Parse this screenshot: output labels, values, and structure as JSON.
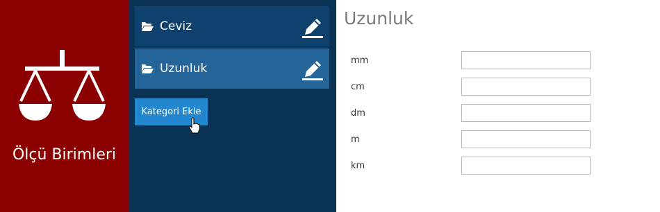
{
  "app": {
    "title": "Ölçü Birimleri",
    "icon": "scale-icon"
  },
  "categories": {
    "items": [
      {
        "label": "Ceviz",
        "icon": "folder-open-icon",
        "edit_icon": "pencil-icon"
      },
      {
        "label": "Uzunluk",
        "icon": "folder-open-icon",
        "edit_icon": "pencil-icon",
        "selected": true
      }
    ],
    "add_button": "Kategori Ekle"
  },
  "content": {
    "title": "Uzunluk",
    "units": [
      {
        "label": "mm",
        "value": ""
      },
      {
        "label": "cm",
        "value": ""
      },
      {
        "label": "dm",
        "value": ""
      },
      {
        "label": "m",
        "value": ""
      },
      {
        "label": "km",
        "value": ""
      }
    ]
  },
  "colors": {
    "left_panel": "#8b0000",
    "mid_panel": "#0a3254",
    "item_bg": "#0e416e",
    "item_selected_bg": "#246498",
    "button_bg": "#2387d0"
  }
}
